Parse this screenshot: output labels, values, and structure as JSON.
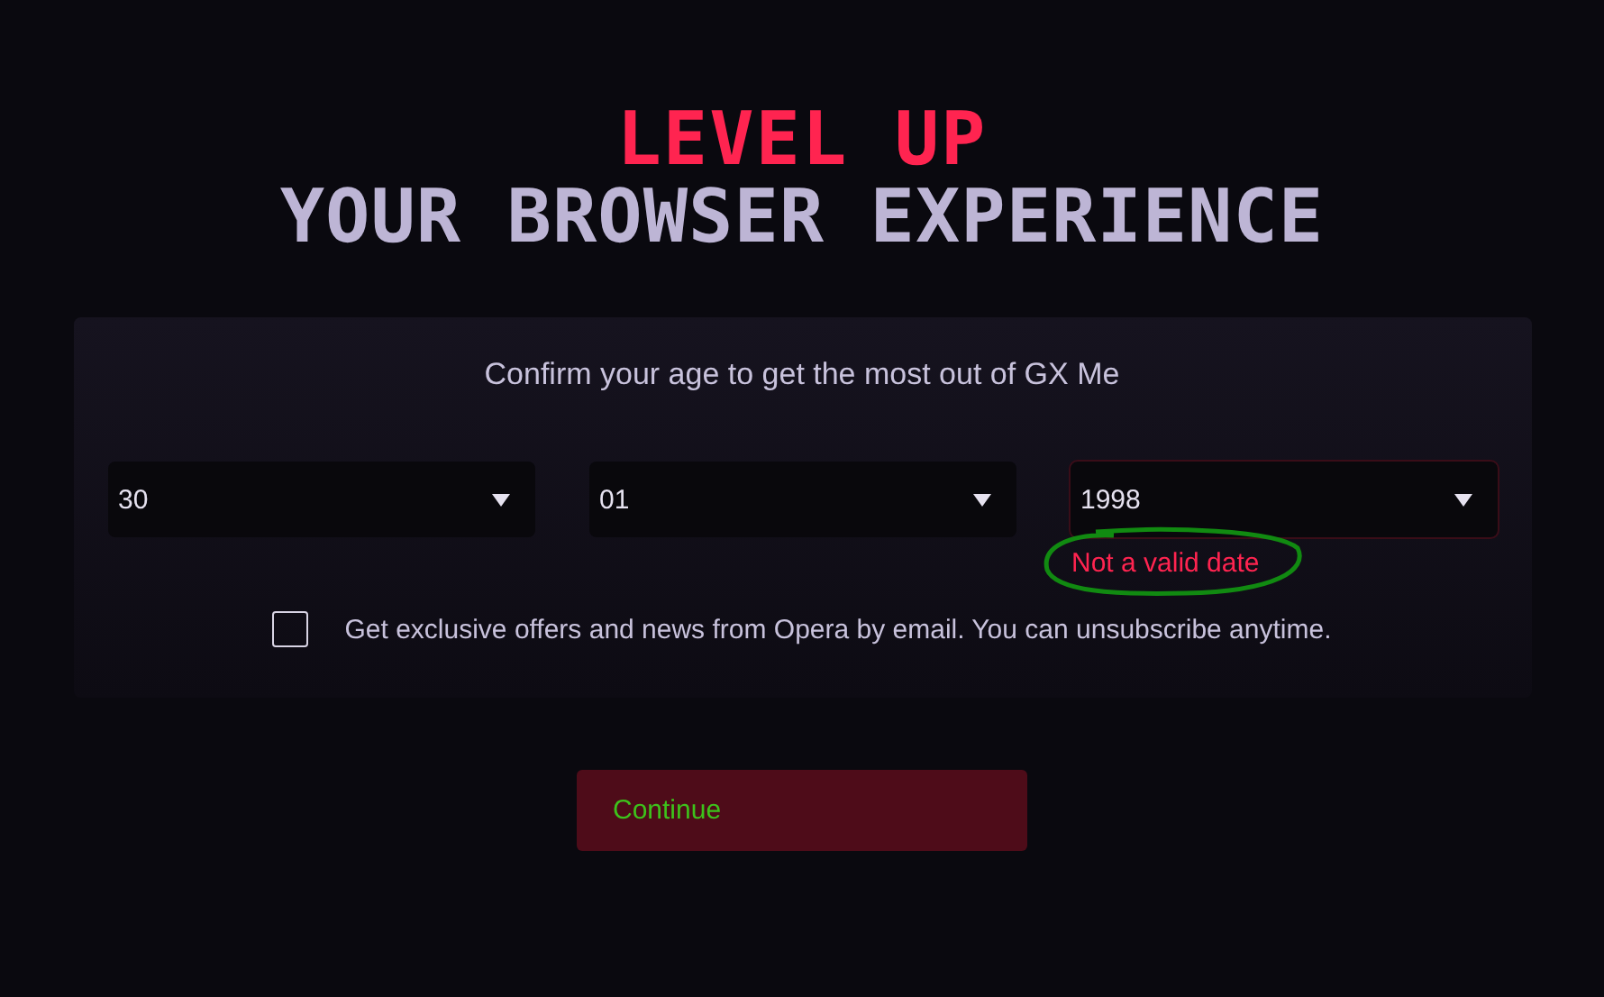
{
  "headline": {
    "line_1": "LEVEL UP",
    "line_2": "YOUR BROWSER EXPERIENCE"
  },
  "card": {
    "prompt": "Confirm your age to get the most out of GX Me",
    "date_fields": [
      {
        "value": "30",
        "error": false
      },
      {
        "value": "01",
        "error": false
      },
      {
        "value": "1998",
        "error": true
      }
    ],
    "error_message": "Not a valid date",
    "annotation": {
      "kind": "circle",
      "color": "#118a11"
    },
    "offers_checkbox": {
      "label": "Get exclusive offers and news from Opera by email. You can unsubscribe anytime.",
      "checked": false
    }
  },
  "continue_button": {
    "label": "Continue",
    "disabled": true
  }
}
